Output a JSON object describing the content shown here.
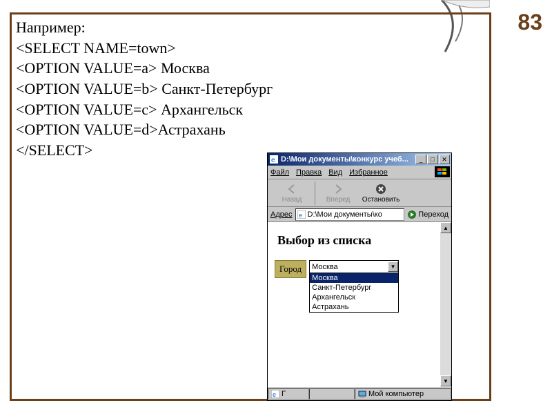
{
  "page_number": "83",
  "code": {
    "l0": "Например:",
    "l1": "<SELECT NAME=town>",
    "l2": " <OPTION VALUE=a> Москва",
    "l3": " <OPTION VALUE=b> Санкт-Петербург",
    "l4": " <OPTION VALUE=c> Архангельск",
    "l5": "<OPTION VALUE=d>Астрахань",
    "l6": " </SELECT>"
  },
  "browser": {
    "title": "D:\\Мои документы\\конкурс учеб...",
    "menu": {
      "file": "Файл",
      "edit": "Правка",
      "view": "Вид",
      "favorites": "Избранное"
    },
    "toolbar": {
      "back": "Назад",
      "forward": "Вперед",
      "stop": "Остановить"
    },
    "address": {
      "label": "Адрес",
      "value": "D:\\Мои документы\\ко",
      "go": "Переход"
    },
    "page": {
      "heading": "Выбор из списка",
      "label": "Город",
      "selected": "Москва",
      "options": [
        "Москва",
        "Санкт-Петербург",
        "Архангельск",
        "Астрахань"
      ]
    },
    "status": {
      "zone": "Мой компьютер"
    }
  }
}
